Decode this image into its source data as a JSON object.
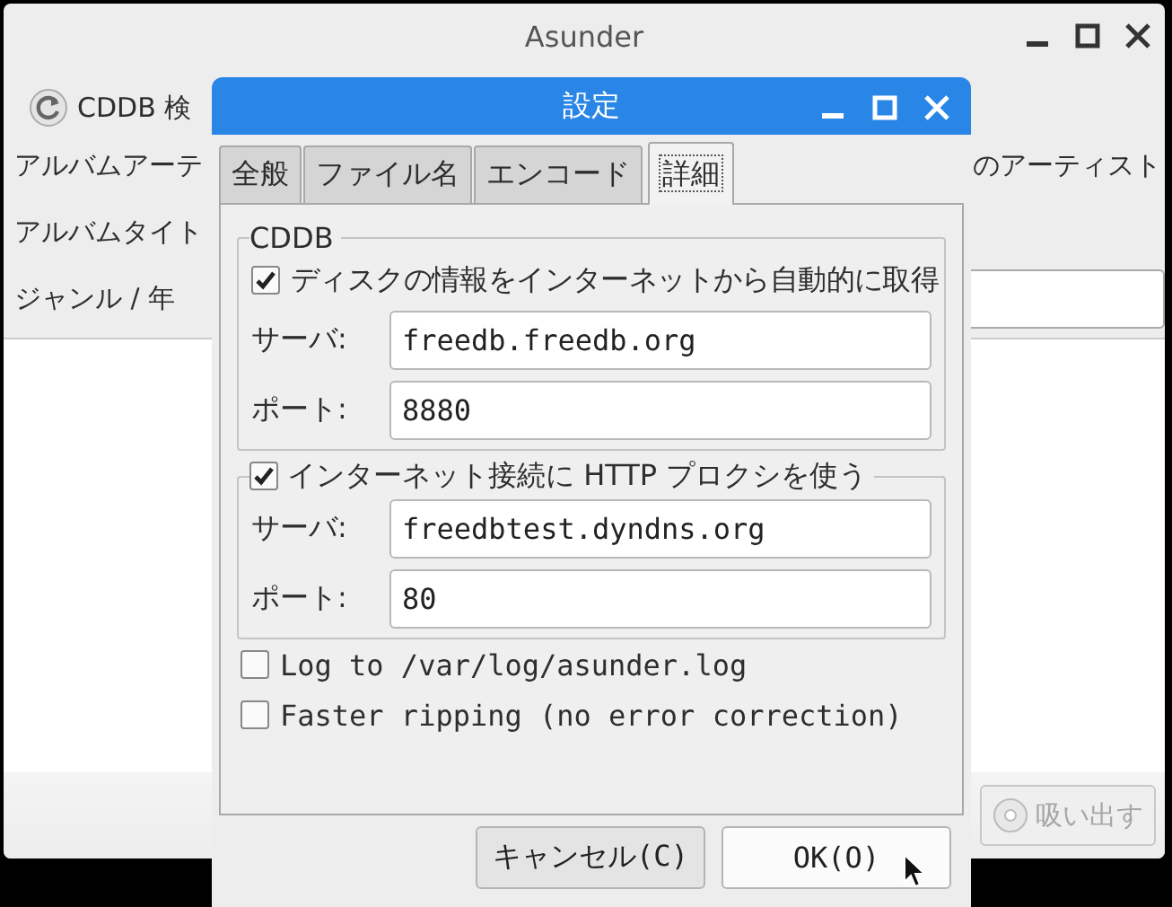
{
  "main_window": {
    "title": "Asunder",
    "toolbar": {
      "button": "CDDB 検"
    },
    "rows": [
      {
        "label": "アルバムアーテ",
        "kind": "text",
        "right": "のアーティスト"
      },
      {
        "label": "アルバムタイト",
        "kind": "none"
      },
      {
        "label": "ジャンル / 年",
        "kind": "entry"
      }
    ],
    "rip_button": {
      "label": "吸い出す",
      "disabled": true
    }
  },
  "dialog": {
    "title": "設定",
    "tabs": [
      {
        "label": "全般",
        "selected": false
      },
      {
        "label": "ファイル名",
        "selected": false
      },
      {
        "label": "エンコード",
        "selected": false
      },
      {
        "label": "詳細",
        "selected": true
      }
    ],
    "cddb": {
      "title": "CDDB",
      "auto_fetch": {
        "label": "ディスクの情報をインターネットから自動的に取得",
        "checked": true
      },
      "fields": [
        {
          "label": "サーバ:",
          "value": "freedb.freedb.org"
        },
        {
          "label": "ポート:",
          "value": "8880"
        }
      ]
    },
    "proxy": {
      "label": "インターネット接続に HTTP プロクシを使う",
      "checked": true,
      "fields": [
        {
          "label": "サーバ:",
          "value": "freedbtest.dyndns.org"
        },
        {
          "label": "ポート:",
          "value": "80"
        }
      ]
    },
    "options": [
      {
        "label": "Log to /var/log/asunder.log",
        "checked": false
      },
      {
        "label": "Faster ripping (no error correction)",
        "checked": false
      }
    ],
    "buttons": [
      {
        "label": "キャンセル(C)",
        "hovered": false
      },
      {
        "label": "OK(O)",
        "hovered": true
      }
    ]
  }
}
